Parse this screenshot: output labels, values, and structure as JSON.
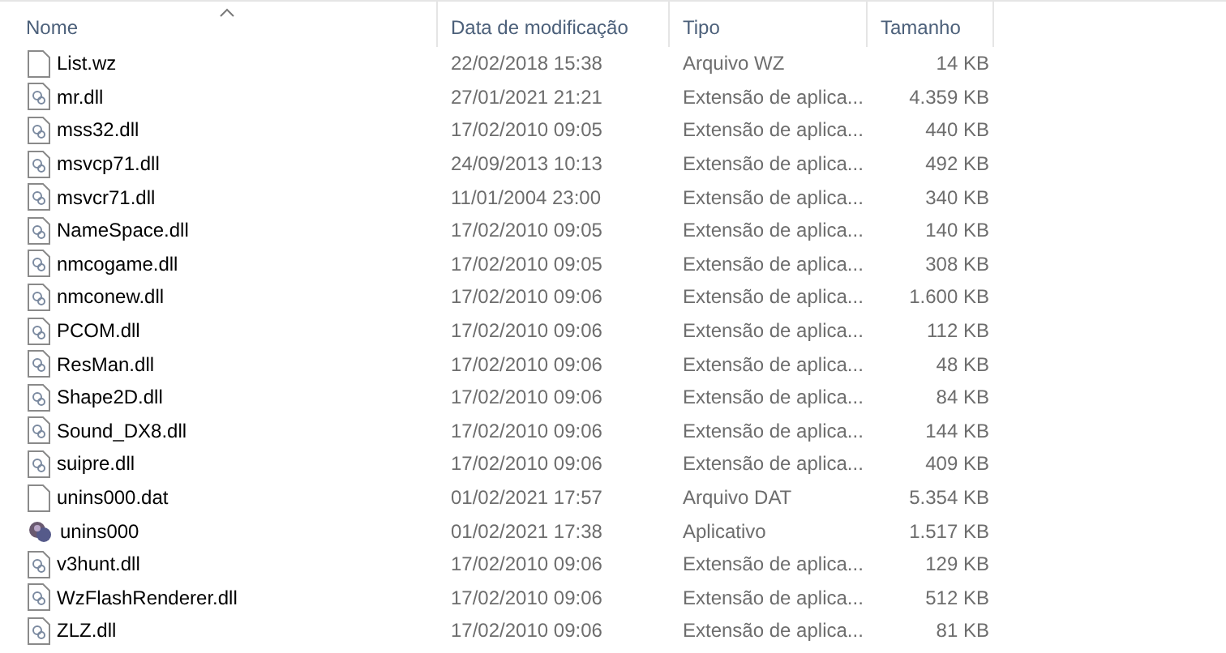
{
  "columns": [
    {
      "label": "Nome",
      "sorted": true
    },
    {
      "label": "Data de modificação",
      "sorted": false
    },
    {
      "label": "Tipo",
      "sorted": false
    },
    {
      "label": "Tamanho",
      "sorted": false
    }
  ],
  "rows": [
    {
      "kind": "file",
      "name": "List.wz",
      "date": "22/02/2018 15:38",
      "type": "Arquivo WZ",
      "size": "14 KB"
    },
    {
      "kind": "dll",
      "name": "mr.dll",
      "date": "27/01/2021 21:21",
      "type": "Extensão de aplica...",
      "size": "4.359 KB"
    },
    {
      "kind": "dll",
      "name": "mss32.dll",
      "date": "17/02/2010 09:05",
      "type": "Extensão de aplica...",
      "size": "440 KB"
    },
    {
      "kind": "dll",
      "name": "msvcp71.dll",
      "date": "24/09/2013 10:13",
      "type": "Extensão de aplica...",
      "size": "492 KB"
    },
    {
      "kind": "dll",
      "name": "msvcr71.dll",
      "date": "11/01/2004 23:00",
      "type": "Extensão de aplica...",
      "size": "340 KB"
    },
    {
      "kind": "dll",
      "name": "NameSpace.dll",
      "date": "17/02/2010 09:05",
      "type": "Extensão de aplica...",
      "size": "140 KB"
    },
    {
      "kind": "dll",
      "name": "nmcogame.dll",
      "date": "17/02/2010 09:05",
      "type": "Extensão de aplica...",
      "size": "308 KB"
    },
    {
      "kind": "dll",
      "name": "nmconew.dll",
      "date": "17/02/2010 09:06",
      "type": "Extensão de aplica...",
      "size": "1.600 KB"
    },
    {
      "kind": "dll",
      "name": "PCOM.dll",
      "date": "17/02/2010 09:06",
      "type": "Extensão de aplica...",
      "size": "112 KB"
    },
    {
      "kind": "dll",
      "name": "ResMan.dll",
      "date": "17/02/2010 09:06",
      "type": "Extensão de aplica...",
      "size": "48 KB"
    },
    {
      "kind": "dll",
      "name": "Shape2D.dll",
      "date": "17/02/2010 09:06",
      "type": "Extensão de aplica...",
      "size": "84 KB"
    },
    {
      "kind": "dll",
      "name": "Sound_DX8.dll",
      "date": "17/02/2010 09:06",
      "type": "Extensão de aplica...",
      "size": "144 KB"
    },
    {
      "kind": "dll",
      "name": "suipre.dll",
      "date": "17/02/2010 09:06",
      "type": "Extensão de aplica...",
      "size": "409 KB"
    },
    {
      "kind": "file",
      "name": "unins000.dat",
      "date": "01/02/2021 17:57",
      "type": "Arquivo DAT",
      "size": "5.354 KB"
    },
    {
      "kind": "app",
      "name": "unins000",
      "date": "01/02/2021 17:38",
      "type": "Aplicativo",
      "size": "1.517 KB"
    },
    {
      "kind": "dll",
      "name": "v3hunt.dll",
      "date": "17/02/2010 09:06",
      "type": "Extensão de aplica...",
      "size": "129 KB"
    },
    {
      "kind": "dll",
      "name": "WzFlashRenderer.dll",
      "date": "17/02/2010 09:06",
      "type": "Extensão de aplica...",
      "size": "512 KB"
    },
    {
      "kind": "dll",
      "name": "ZLZ.dll",
      "date": "17/02/2010 09:06",
      "type": "Extensão de aplica...",
      "size": "81 KB"
    }
  ]
}
